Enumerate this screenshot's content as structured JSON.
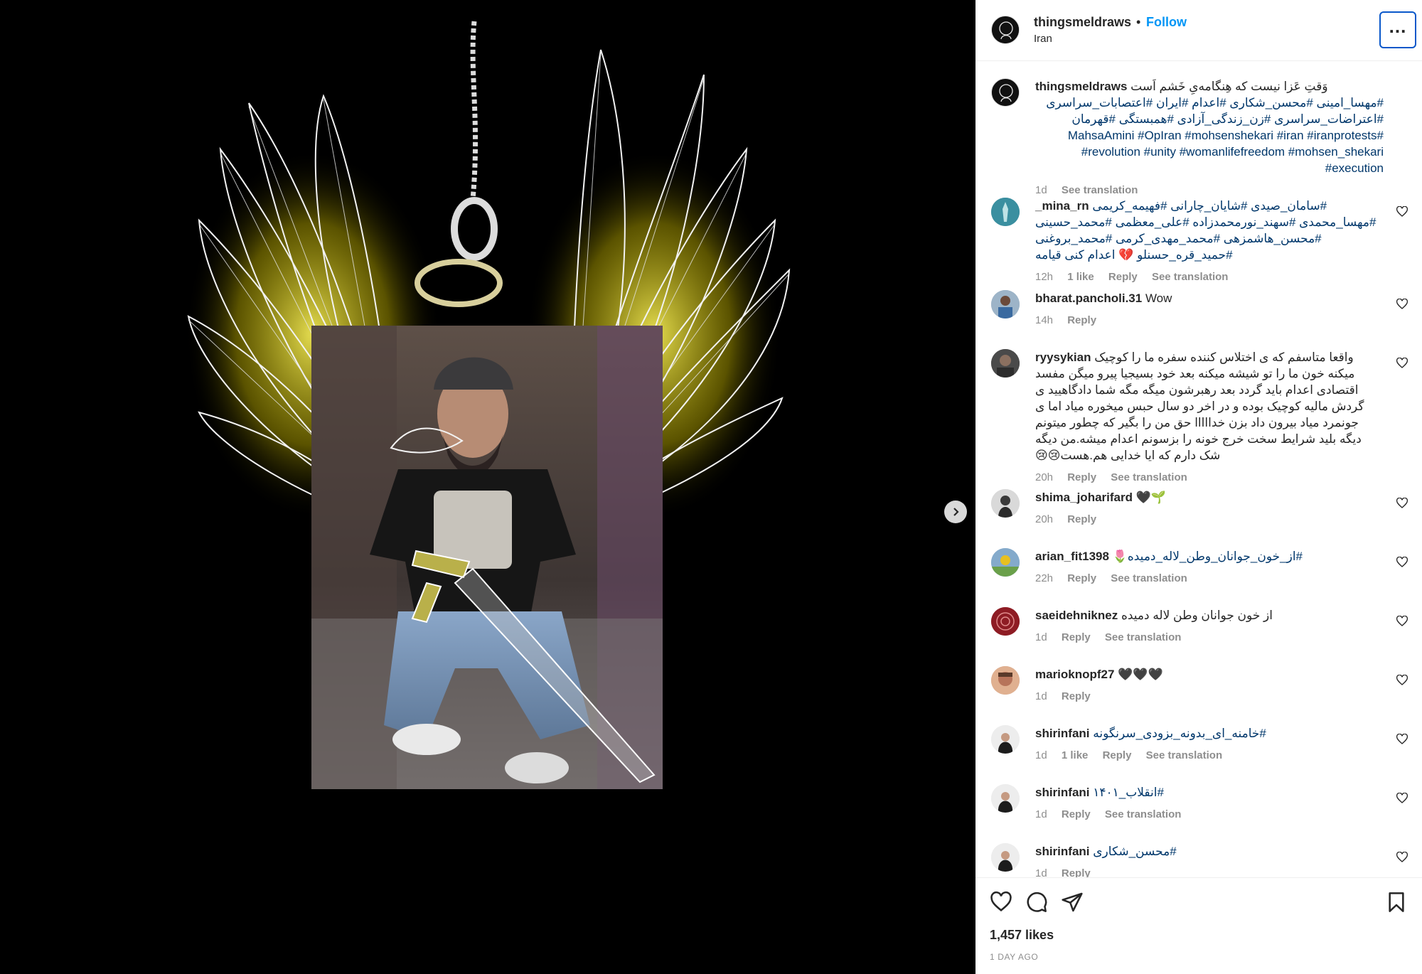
{
  "post": {
    "username": "thingsmeldraws",
    "separator": "•",
    "follow_label": "Follow",
    "location": "Iran",
    "more_label": "..."
  },
  "caption": {
    "username": "thingsmeldraws",
    "text_line1": "وَقتِ عَزا نیست که هِنگامه‌یِ خَشم اَست",
    "hashtags": "#مهسا_امینی #محسن_شکاری #اعدام #ایران #اعتصابات_سراسری #اعتراضات_سراسری #زن_زندگی_آزادی #همبستگی #قهرمان #MahsaAmini #OpIran #mohsenshekari #iran #iranprotests #revolution #unity #womanlifefreedom #mohsen_shekari #execution",
    "time": "1d",
    "see_translation": "See translation"
  },
  "comments": [
    {
      "username": "_mina_rn",
      "text": "#سامان_صیدی #شایان_چارانی #فهیمه_کریمی #مهسا_محمدی #سهند_نورمحمدزاده #علی_معظمی #محمد_حسینی #محسن_هاشمزهی #محمد_مهدی_کرمی #محمد_بروغنی #حمید_قره_حسنلو 💔 اعدام کنی قیامه",
      "time": "12h",
      "likes": "1 like",
      "reply": "Reply",
      "translation": "See translation"
    },
    {
      "username": "bharat.pancholi.31",
      "text": "Wow",
      "time": "14h",
      "reply": "Reply"
    },
    {
      "username": "ryysykian",
      "text": "واقعا متاسفم که ی اختلاس کننده سفره ما را کوچیک میکنه خون ما را تو شیشه میکنه بعد خود بسیجیا پیرو میگن مفسد اقتصادی اعدام باید گردد بعد رهبرشون میگه مگه شما دادگاهیید ی گردش مالیه کوچیک بوده و در اخر دو سال حبس میخوره میاد اما ی جونمرد میاد بیرون داد بزن خدااااا حق من را بگیر که چطور میتونم دیگه بلید شرایط سخت خرج خونه را بزسونم اعدام میشه.من دیگه شک دارم که ایا خدایی هم.هست😢😢",
      "time": "20h",
      "reply": "Reply",
      "translation": "See translation"
    },
    {
      "username": "shima_joharifard",
      "text": "🖤🌱",
      "time": "20h",
      "reply": "Reply"
    },
    {
      "username": "arian_fit1398",
      "text": "#از_خون_جوانان_وطن_لاله_دمیده🌷",
      "time": "22h",
      "reply": "Reply",
      "translation": "See translation"
    },
    {
      "username": "saeidehniknez",
      "text": "از خون جوانان وطن لاله دمیده",
      "time": "1d",
      "reply": "Reply",
      "translation": "See translation"
    },
    {
      "username": "marioknopf27",
      "text": "🖤🖤🖤",
      "time": "1d",
      "reply": "Reply"
    },
    {
      "username": "shirinfani",
      "text": "#خامنه_ای_بدونه_بزودی_سرنگونه",
      "time": "1d",
      "likes": "1 like",
      "reply": "Reply",
      "translation": "See translation"
    },
    {
      "username": "shirinfani",
      "text": "#انقلاب_۱۴۰۱",
      "time": "1d",
      "reply": "Reply",
      "translation": "See translation"
    },
    {
      "username": "shirinfani",
      "text": "#محسن_شکاری",
      "time": "1d",
      "reply": "Reply"
    }
  ],
  "footer": {
    "likes": "1,457 likes",
    "age": "1 DAY AGO"
  },
  "icons": {
    "like": "heart-icon",
    "comment": "comment-icon",
    "share": "share-icon",
    "save": "bookmark-icon",
    "next": "chevron-right-icon"
  },
  "colors": {
    "link": "#0095f6",
    "hashtag": "#00376b",
    "muted": "#8e8e8e",
    "text": "#262626",
    "wing_glow": "#e6d800"
  }
}
